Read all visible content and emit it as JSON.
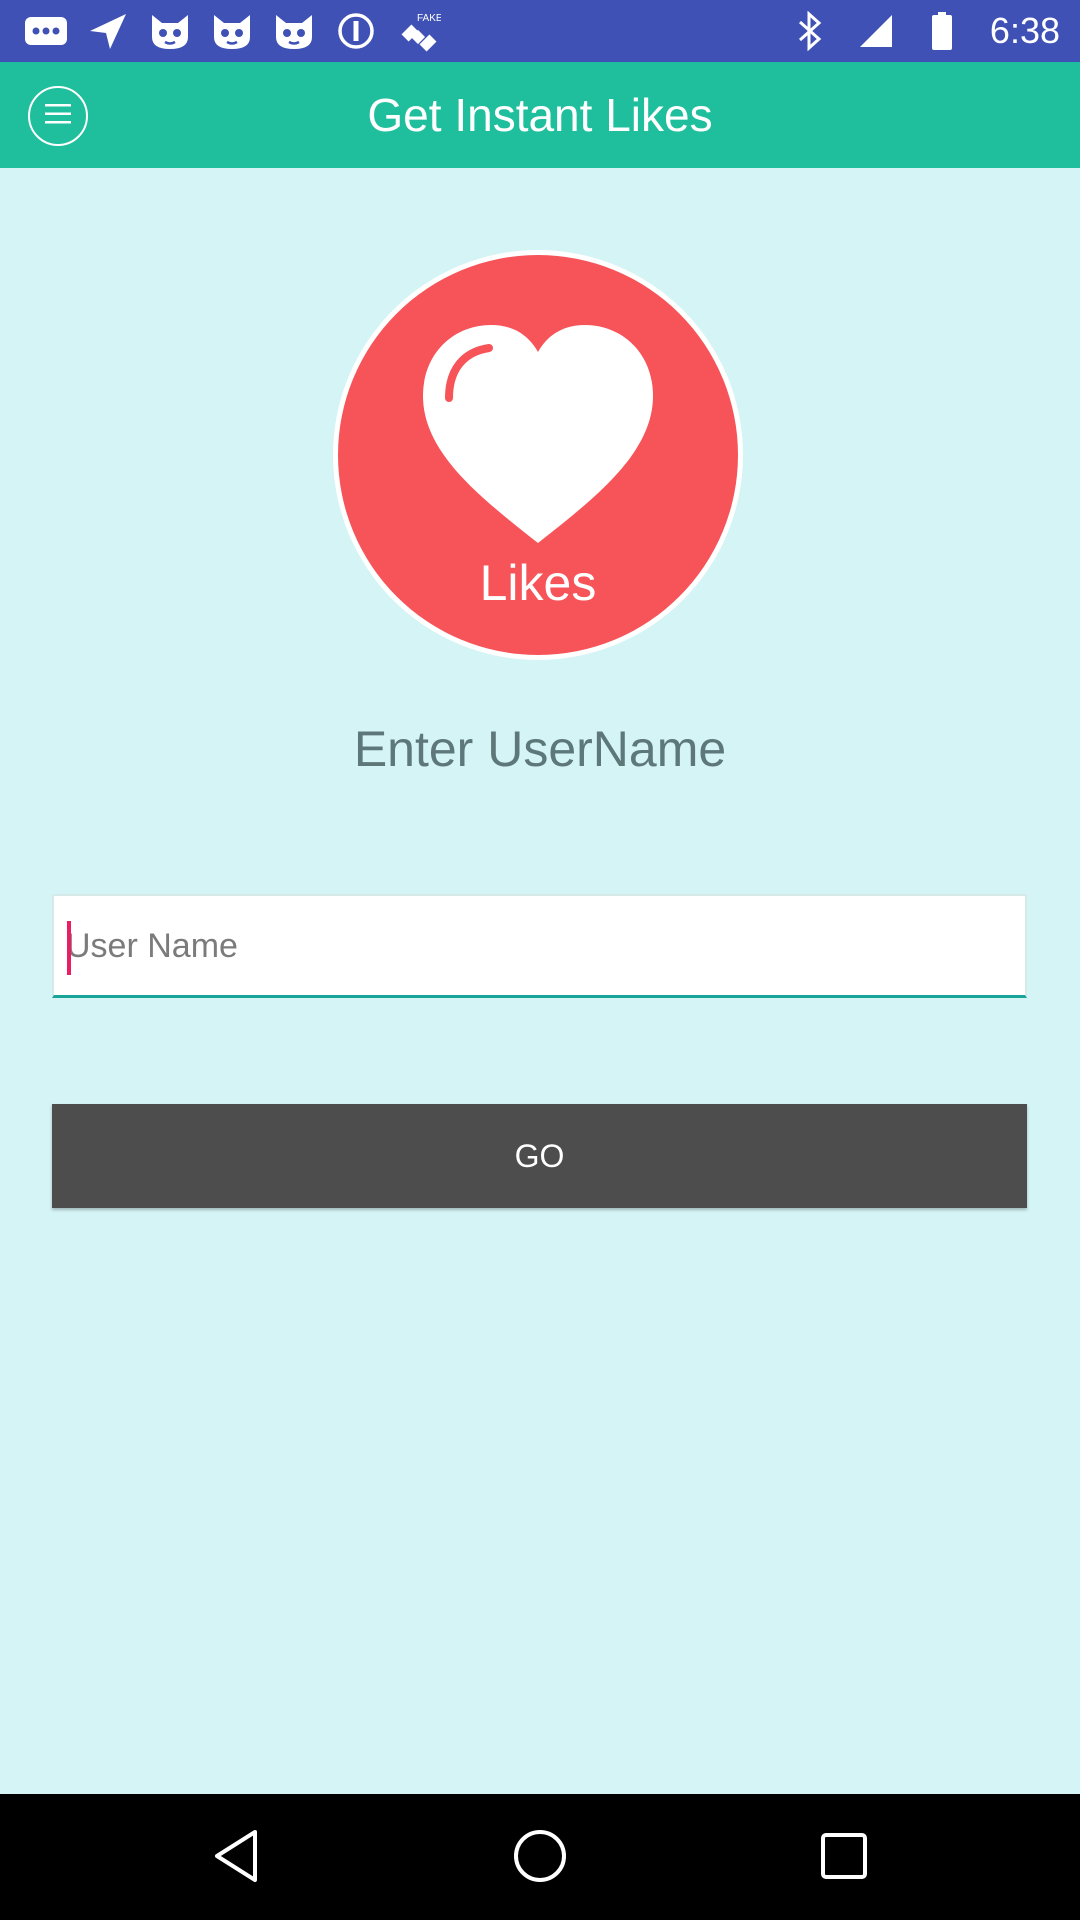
{
  "status_bar": {
    "time": "6:38",
    "icons": [
      "more-icon",
      "navigation-icon",
      "cat-face-icon",
      "cat-face-icon",
      "cat-face-icon",
      "info-icon",
      "fake-gps-icon",
      "bluetooth-icon",
      "signal-icon",
      "battery-icon"
    ],
    "fake_label": "FAKE"
  },
  "app_bar": {
    "title": "Get Instant Likes",
    "menu_icon": "menu-icon"
  },
  "logo": {
    "label": "Likes",
    "circle_color": "#f65459",
    "heart_color": "#ffffff"
  },
  "form": {
    "heading": "Enter UserName",
    "username_placeholder": "User Name",
    "username_value": "",
    "go_label": "GO"
  },
  "colors": {
    "status_bar": "#3f51b5",
    "app_bar": "#1fbf9e",
    "background": "#d5f4f6",
    "button": "#4d4d4d",
    "accent_cursor": "#e91e63"
  },
  "nav_bar": {
    "buttons": [
      "back-icon",
      "home-icon",
      "recents-icon"
    ]
  }
}
